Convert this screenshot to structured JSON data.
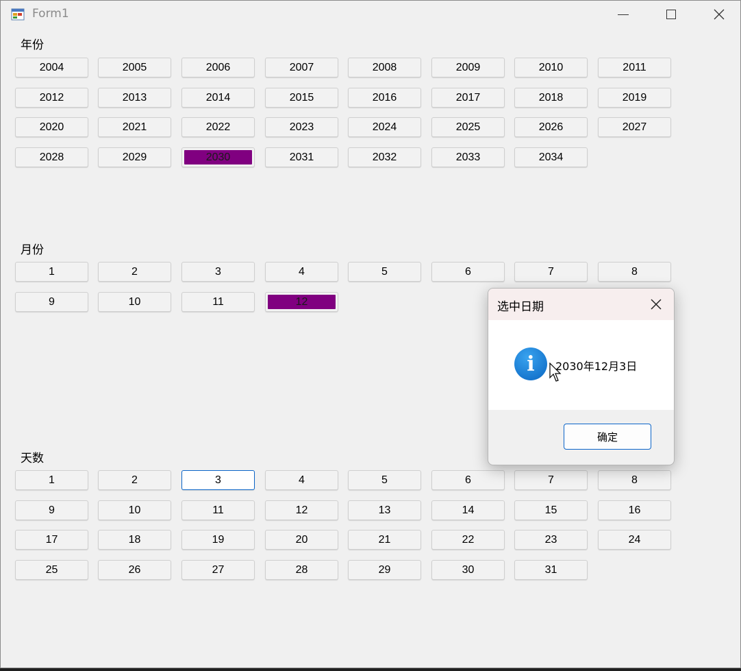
{
  "window": {
    "title": "Form1"
  },
  "sections": {
    "year_label": "年份",
    "month_label": "月份",
    "day_label": "天数"
  },
  "years": [
    "2004",
    "2005",
    "2006",
    "2007",
    "2008",
    "2009",
    "2010",
    "2011",
    "2012",
    "2013",
    "2014",
    "2015",
    "2016",
    "2017",
    "2018",
    "2019",
    "2020",
    "2021",
    "2022",
    "2023",
    "2024",
    "2025",
    "2026",
    "2027",
    "2028",
    "2029",
    "2030",
    "2031",
    "2032",
    "2033",
    "2034"
  ],
  "months": [
    "1",
    "2",
    "3",
    "4",
    "5",
    "6",
    "7",
    "8",
    "9",
    "10",
    "11",
    "12"
  ],
  "days": [
    "1",
    "2",
    "3",
    "4",
    "5",
    "6",
    "7",
    "8",
    "9",
    "10",
    "11",
    "12",
    "13",
    "14",
    "15",
    "16",
    "17",
    "18",
    "19",
    "20",
    "21",
    "22",
    "23",
    "24",
    "25",
    "26",
    "27",
    "28",
    "29",
    "30",
    "31"
  ],
  "selected": {
    "year": "2030",
    "month": "12",
    "day": "3"
  },
  "colors": {
    "selected_fill": "#800080",
    "focus_border": "#0a64c8",
    "info_icon": "#0a66c2"
  },
  "dialog": {
    "title": "选中日期",
    "message": "2030年12月3日",
    "ok_label": "确定",
    "icon": "info-icon"
  }
}
